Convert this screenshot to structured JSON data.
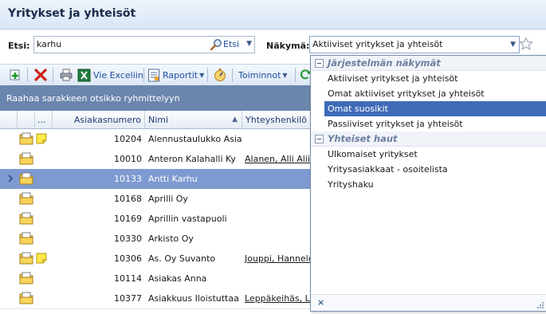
{
  "window": {
    "title": "Yritykset ja yhteisöt"
  },
  "search": {
    "label": "Etsi:",
    "value": "karhu",
    "button_label": "Etsi"
  },
  "view": {
    "label": "Näkymä:",
    "value": "Aktiiviset yritykset ja yhteisöt"
  },
  "toolbar": {
    "excel_label": "Vie Exceliin",
    "reports_label": "Raportit",
    "actions_label": "Toiminnot"
  },
  "grid": {
    "group_hint": "Raahaa sarakkeen otsikko ryhmittelyyn",
    "headers": {
      "more": "...",
      "customer_number": "Asiakasnumero",
      "name": "Nimi",
      "contact": "Yhteyshenkilö"
    },
    "sort_indicator": "▲",
    "rows": [
      {
        "number": "10204",
        "name": "Alennustaulukko Asia...",
        "contact": "",
        "note": true,
        "selected": false
      },
      {
        "number": "10010",
        "name": "Anteron Kalahalli Ky",
        "contact": "Alanen, Alli Aliisa",
        "note": false,
        "selected": false
      },
      {
        "number": "10133",
        "name": "Antti Karhu",
        "contact": "",
        "note": false,
        "selected": true
      },
      {
        "number": "10168",
        "name": "Aprilli Oy",
        "contact": "",
        "note": false,
        "selected": false
      },
      {
        "number": "10169",
        "name": "Aprillin vastapuoli",
        "contact": "",
        "note": false,
        "selected": false
      },
      {
        "number": "10330",
        "name": "Arkisto Oy",
        "contact": "",
        "note": false,
        "selected": false
      },
      {
        "number": "10306",
        "name": "As. Oy Suvanto",
        "contact": "Jouppi, Hannele",
        "note": true,
        "selected": false
      },
      {
        "number": "10114",
        "name": "Asiakas Anna",
        "contact": "",
        "note": false,
        "selected": false
      },
      {
        "number": "10377",
        "name": "Asiakkuus Iloistuttaa ...",
        "contact": "Leppäkeihäs, Lee",
        "note": false,
        "selected": false
      }
    ]
  },
  "view_dropdown": {
    "groups": [
      {
        "label": "Järjestelmän näkymät",
        "items": [
          "Aktiiviset yritykset ja yhteisöt",
          "Omat aktiiviset yritykset ja yhteisöt",
          "Omat suosikit",
          "Passiiviset yritykset ja yhteisöt"
        ]
      },
      {
        "label": "Yhteiset haut",
        "items": [
          "Ulkomaiset yritykset",
          "Yritysasiakkaat - osoitelista",
          "Yrityshaku"
        ]
      }
    ],
    "highlighted_item": "Omat suosikit",
    "close_glyph": "×"
  },
  "colors": {
    "selected_row": "#7e9ad0",
    "highlight": "#3f6bb8",
    "group_bar": "#6b86ad",
    "accent_text": "#1f4ea0"
  }
}
